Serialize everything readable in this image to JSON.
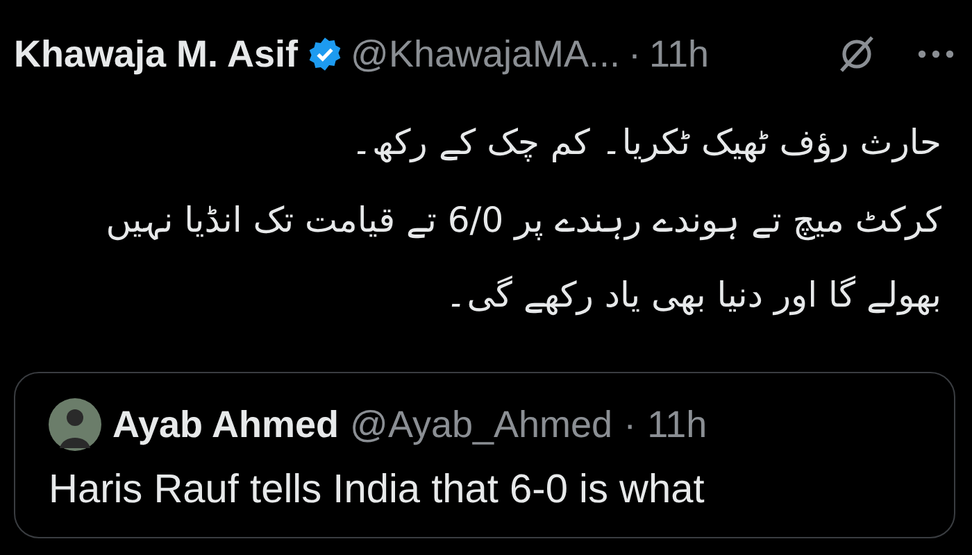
{
  "tweet": {
    "author": "Khawaja M. Asif",
    "verified": true,
    "handle": "@KhawajaMA...",
    "separator": "·",
    "time": "11h",
    "paragraphs": [
      "حارث رؤف ٹھیک ٹکریا۔ کم چک کے رکھ۔",
      "کرکٹ میچ تے ہوندے رہندے پر 6/0 تے قیامت تک انڈیا نہیں بھولے گا اور دنیا بھی یاد رکھے گی۔"
    ]
  },
  "quoted_tweet": {
    "author": "Ayab Ahmed",
    "handle": "@Ayab_Ahmed",
    "separator": "·",
    "time": "11h",
    "text": "Haris Rauf tells India that 6-0 is what"
  }
}
